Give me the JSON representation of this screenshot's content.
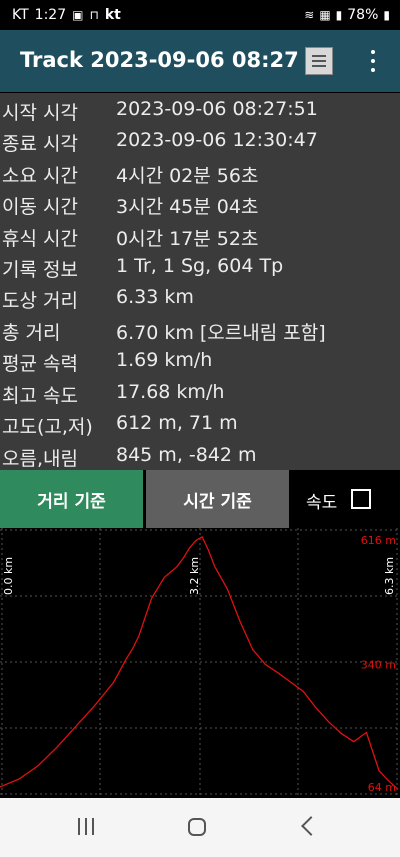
{
  "status_bar": {
    "carrier": "KT",
    "time": "1:27",
    "left_icons": [
      "image-icon",
      "hd-icon",
      "kt-icon"
    ],
    "kt_label": "kt",
    "battery": "78%"
  },
  "app_bar": {
    "title": "Track 2023-09-06 08:27"
  },
  "info": [
    {
      "label": "시작 시각",
      "value": "2023-09-06 08:27:51"
    },
    {
      "label": "종료 시각",
      "value": "2023-09-06 12:30:47"
    },
    {
      "label": "소요 시간",
      "value": "4시간 02분 56초"
    },
    {
      "label": "이동 시간",
      "value": "3시간 45분 04초"
    },
    {
      "label": "휴식 시간",
      "value": "0시간 17분 52초"
    },
    {
      "label": "기록 정보",
      "value": "1 Tr, 1 Sg, 604 Tp"
    },
    {
      "label": "도상 거리",
      "value": "6.33 km"
    },
    {
      "label": "총 거리",
      "value": "6.70 km [오르내림 포함]"
    },
    {
      "label": "평균 속력",
      "value": "1.69 km/h"
    },
    {
      "label": "최고 속도",
      "value": "17.68 km/h"
    },
    {
      "label": "고도(고,저)",
      "value": "612 m, 71 m"
    },
    {
      "label": "오름,내림",
      "value": "845 m, -842 m"
    }
  ],
  "tabs": {
    "distance": "거리 기준",
    "time": "시간 기준",
    "speed": "속도"
  },
  "chart_data": {
    "type": "line",
    "x_unit": "km",
    "y_unit": "m",
    "x_ticks": [
      "0.0 km",
      "3.2 km",
      "6.3 km"
    ],
    "y_ticks": [
      "616 m",
      "340 m",
      "64 m"
    ],
    "ylim": [
      64,
      616
    ],
    "xlim": [
      0,
      6.3
    ],
    "grid": true,
    "colors": {
      "line": "#e01010",
      "grid": "#555555",
      "label": "#e01010",
      "xlabel": "#ffffff"
    },
    "x": [
      0.0,
      0.3,
      0.6,
      0.9,
      1.2,
      1.5,
      1.8,
      2.0,
      2.1,
      2.2,
      2.4,
      2.6,
      2.8,
      2.9,
      3.0,
      3.1,
      3.2,
      3.3,
      3.4,
      3.6,
      3.8,
      4.0,
      4.2,
      4.4,
      4.6,
      4.8,
      5.0,
      5.2,
      5.4,
      5.6,
      5.8,
      6.0,
      6.15,
      6.3
    ],
    "y": [
      75,
      92,
      120,
      160,
      205,
      250,
      300,
      350,
      372,
      400,
      480,
      525,
      548,
      566,
      588,
      604,
      612,
      583,
      548,
      500,
      430,
      370,
      338,
      320,
      300,
      280,
      245,
      215,
      190,
      172,
      192,
      110,
      88,
      70
    ]
  },
  "navbar": {
    "icons": [
      "recent-apps-icon",
      "home-icon",
      "back-icon"
    ]
  }
}
